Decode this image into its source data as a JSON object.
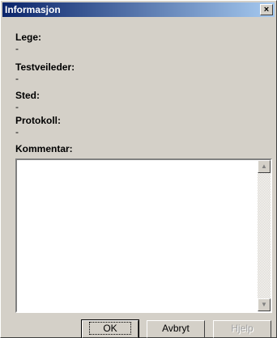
{
  "window": {
    "title": "Informasjon",
    "close": "×"
  },
  "fields": [
    {
      "label": "Lege:",
      "value": "-"
    },
    {
      "label": "Testveileder:",
      "value": "-"
    },
    {
      "label": "Sted:",
      "value": "-"
    },
    {
      "label": "Protokoll:",
      "value": "-"
    }
  ],
  "comment": {
    "label": "Kommentar:",
    "value": ""
  },
  "buttons": {
    "ok": "OK",
    "cancel": "Avbryt",
    "help": "Hjelp"
  }
}
